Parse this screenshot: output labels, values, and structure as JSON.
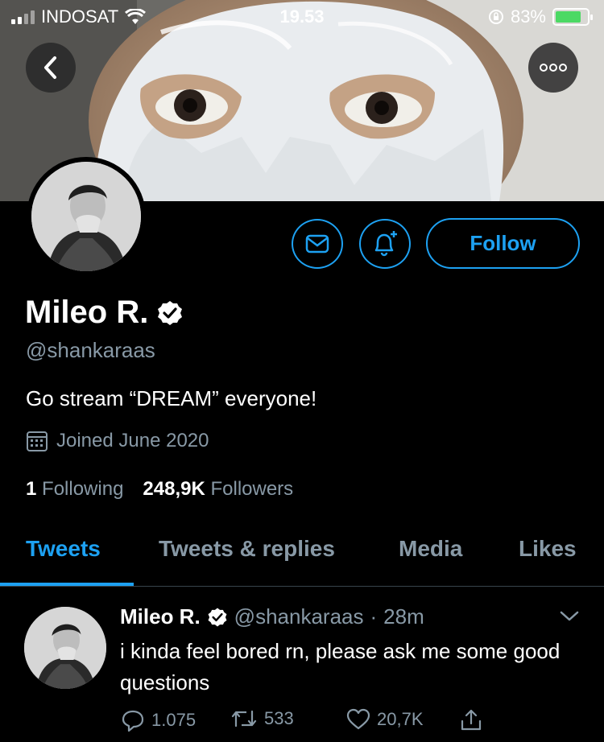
{
  "status_bar": {
    "carrier": "INDOSAT",
    "time": "19.53",
    "battery": "83%",
    "battery_level": 0.83
  },
  "header": {
    "back_icon": "chevron-left-icon",
    "more_icon": "ellipsis-icon"
  },
  "profile": {
    "display_name": "Mileo R.",
    "handle": "@shankaraas",
    "bio": "Go stream “DREAM” everyone!",
    "joined": "Joined June 2020",
    "following_count": "1",
    "following_label": "Following",
    "followers_count": "248,9K",
    "followers_label": "Followers",
    "follow_button": "Follow"
  },
  "tabs": [
    {
      "label": "Tweets",
      "active": true
    },
    {
      "label": "Tweets & replies",
      "active": false
    },
    {
      "label": "Media",
      "active": false
    },
    {
      "label": "Likes",
      "active": false
    }
  ],
  "tweet": {
    "name": "Mileo R.",
    "handle": "@shankaraas",
    "separator": "·",
    "time": "28m",
    "text": "i kinda feel bored rn, please ask me some good questions",
    "replies": "1.075",
    "retweets": "533",
    "likes": "20,7K"
  },
  "colors": {
    "accent": "#1da1f2",
    "muted": "#8899a6",
    "background": "#000000"
  }
}
